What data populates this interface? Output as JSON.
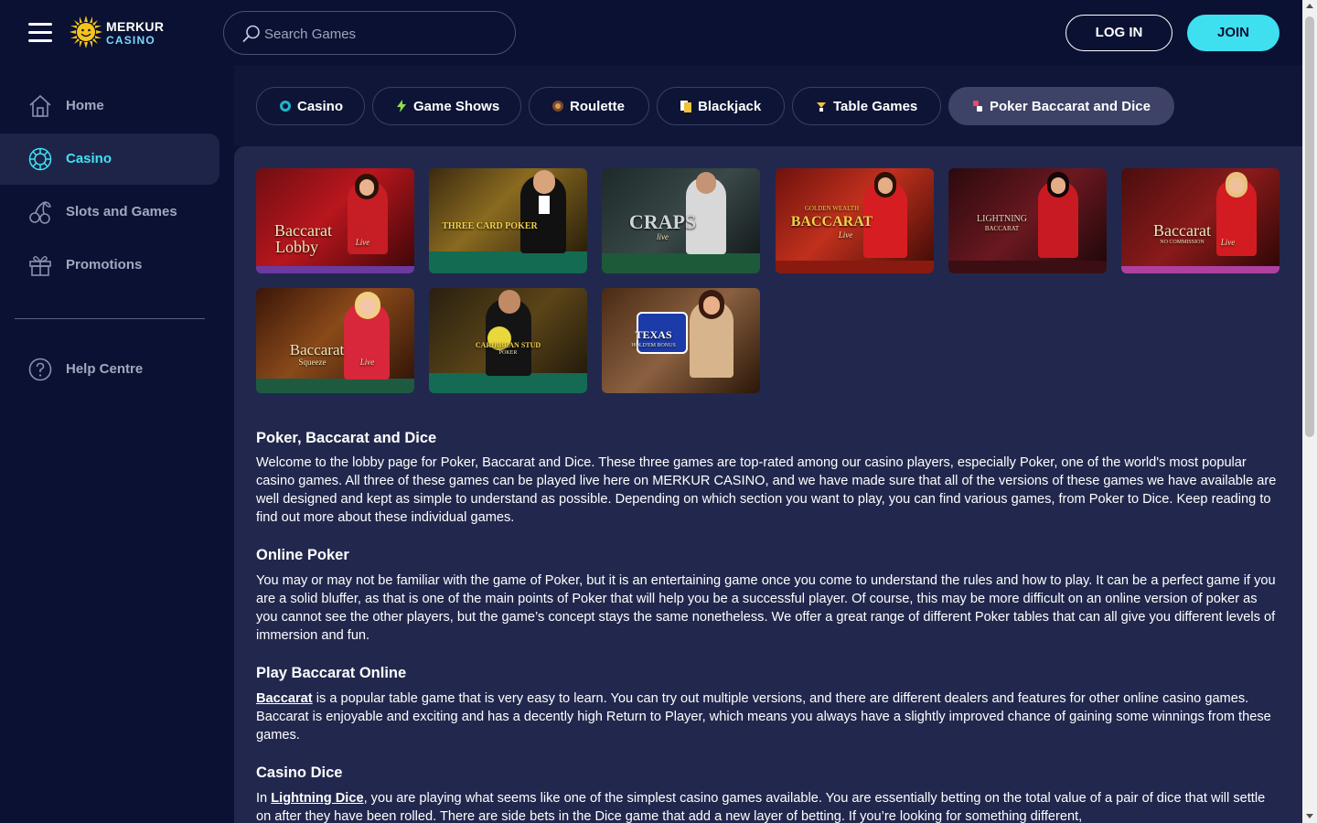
{
  "header": {
    "logo_line1": "MERKUR",
    "logo_line2": "CASINO",
    "search_placeholder": "Search Games",
    "login_label": "LOG IN",
    "join_label": "JOIN"
  },
  "sidebar": {
    "items": [
      {
        "label": "Home",
        "icon": "home-icon"
      },
      {
        "label": "Casino",
        "icon": "casino-chip-icon",
        "active": true
      },
      {
        "label": "Slots and Games",
        "icon": "cherries-icon"
      },
      {
        "label": "Promotions",
        "icon": "gift-icon"
      }
    ],
    "help_label": "Help Centre"
  },
  "categories": [
    {
      "label": "Casino",
      "icon": "casino-chip-icon"
    },
    {
      "label": "Game Shows",
      "icon": "lightning-icon"
    },
    {
      "label": "Roulette",
      "icon": "roulette-icon"
    },
    {
      "label": "Blackjack",
      "icon": "cards-icon"
    },
    {
      "label": "Table Games",
      "icon": "table-games-icon"
    },
    {
      "label": "Poker Baccarat and Dice",
      "icon": "dice-icon",
      "active": true
    }
  ],
  "games": [
    {
      "title": "Baccarat",
      "subtitle": "Lobby",
      "tag": "Live"
    },
    {
      "title": "THREE CARD POKER",
      "subtitle": "",
      "tag": ""
    },
    {
      "title": "CRAPS",
      "subtitle": "",
      "tag": "live"
    },
    {
      "title": "BACCARAT",
      "subtitle": "GOLDEN WEALTH",
      "tag": "Live"
    },
    {
      "title": "LIGHTNING",
      "subtitle": "BACCARAT",
      "tag": ""
    },
    {
      "title": "Baccarat",
      "subtitle": "NO COMMISSION",
      "tag": "Live"
    },
    {
      "title": "Baccarat",
      "subtitle": "Squeeze",
      "tag": "Live"
    },
    {
      "title": "CARIBBEAN STUD",
      "subtitle": "POKER",
      "tag": ""
    },
    {
      "title": "TEXAS",
      "subtitle": "HOLD'EM BONUS",
      "tag": ""
    }
  ],
  "article": {
    "sections": [
      {
        "heading": "Poker, Baccarat and Dice",
        "body": "Welcome to the lobby page for Poker, Baccarat and Dice. These three games are top-rated among our casino players, especially Poker, one of the world's most popular casino games. All three of these games can be played live here on MERKUR CASINO, and we have made sure that all of the versions of these games we have available are well designed and kept as simple to understand as possible. Depending on which section you want to play, you can find various games, from Poker to Dice. Keep reading to find out more about these individual games."
      },
      {
        "heading": "Online Poker",
        "body": "You may or may not be familiar with the game of Poker, but it is an entertaining game once you come to understand the rules and how to play. It can be a perfect game if you are a solid bluffer, as that is one of the main points of Poker that will help you be a successful player. Of course, this may be more difficult on an online version of poker as you cannot see the other players, but the game’s concept stays the same nonetheless. We offer a great range of different Poker tables that can all give you different levels of immersion and fun."
      },
      {
        "heading": "Play Baccarat Online",
        "link": "Baccarat",
        "body": " is a popular table game that is very easy to learn. You can try out multiple versions, and there are different dealers and features for other online casino games. Baccarat is enjoyable and exciting and has a decently high Return to Player, which means you always have a slightly improved chance of gaining some winnings from these games."
      },
      {
        "heading": "Casino Dice",
        "prefix": "In ",
        "link": "Lightning Dice",
        "body": ", you are playing what seems like one of the simplest casino games available. You are essentially betting on the total value of a pair of dice that will settle on after they have been rolled. There are side bets in the Dice game that add a new layer of betting. If you’re looking for something different,"
      }
    ]
  },
  "colors": {
    "background": "#0b1132",
    "accent": "#3ee0ef",
    "content_panel": "#22284d",
    "active_nav": "#1d2448"
  }
}
